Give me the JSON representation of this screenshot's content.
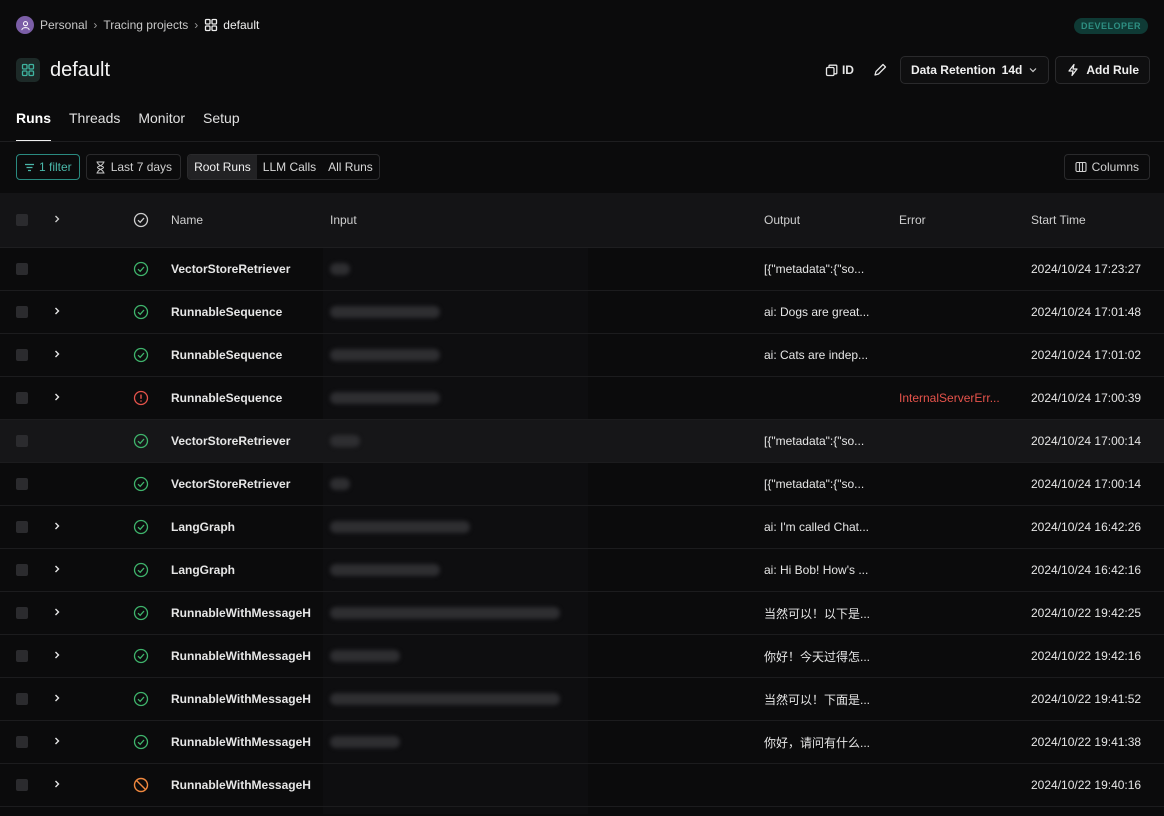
{
  "breadcrumb": {
    "workspace": "Personal",
    "section": "Tracing projects",
    "current": "default"
  },
  "badge": "DEVELOPER",
  "title": "default",
  "actions": {
    "id_label": "ID",
    "retention_label": "Data Retention",
    "retention_value": "14d",
    "add_rule_label": "Add Rule"
  },
  "tabs": [
    "Runs",
    "Threads",
    "Monitor",
    "Setup"
  ],
  "filters": {
    "filter_label": "1 filter",
    "days_label": "Last 7 days",
    "segments": [
      "Root Runs",
      "LLM Calls",
      "All Runs"
    ],
    "columns_label": "Columns"
  },
  "table": {
    "headers": {
      "name": "Name",
      "input": "Input",
      "output": "Output",
      "error": "Error",
      "start": "Start Time"
    },
    "rows": [
      {
        "expand": false,
        "status": "success",
        "name": "VectorStoreRetriever",
        "output": "[{\"metadata\":{\"so...",
        "error": "",
        "start": "2024/10/24 17:23:27"
      },
      {
        "expand": true,
        "status": "success",
        "name": "RunnableSequence",
        "output": "ai: Dogs are great...",
        "error": "",
        "start": "2024/10/24 17:01:48"
      },
      {
        "expand": true,
        "status": "success",
        "name": "RunnableSequence",
        "output": "ai: Cats are indep...",
        "error": "",
        "start": "2024/10/24 17:01:02"
      },
      {
        "expand": true,
        "status": "error",
        "name": "RunnableSequence",
        "output": "",
        "error": "InternalServerErr...",
        "start": "2024/10/24 17:00:39"
      },
      {
        "expand": false,
        "status": "success",
        "name": "VectorStoreRetriever",
        "output": "[{\"metadata\":{\"so...",
        "error": "",
        "start": "2024/10/24 17:00:14"
      },
      {
        "expand": false,
        "status": "success",
        "name": "VectorStoreRetriever",
        "output": "[{\"metadata\":{\"so...",
        "error": "",
        "start": "2024/10/24 17:00:14"
      },
      {
        "expand": true,
        "status": "success",
        "name": "LangGraph",
        "output": "ai: I'm called Chat...",
        "error": "",
        "start": "2024/10/24 16:42:26"
      },
      {
        "expand": true,
        "status": "success",
        "name": "LangGraph",
        "output": "ai: Hi Bob! How's ...",
        "error": "",
        "start": "2024/10/24 16:42:16"
      },
      {
        "expand": true,
        "status": "success",
        "name": "RunnableWithMessageH",
        "output": "当然可以！以下是...",
        "error": "",
        "start": "2024/10/22 19:42:25"
      },
      {
        "expand": true,
        "status": "success",
        "name": "RunnableWithMessageH",
        "output": "你好！今天过得怎...",
        "error": "",
        "start": "2024/10/22 19:42:16"
      },
      {
        "expand": true,
        "status": "success",
        "name": "RunnableWithMessageH",
        "output": "当然可以！下面是...",
        "error": "",
        "start": "2024/10/22 19:41:52"
      },
      {
        "expand": true,
        "status": "success",
        "name": "RunnableWithMessageH",
        "output": "你好，请问有什么...",
        "error": "",
        "start": "2024/10/22 19:41:38"
      },
      {
        "expand": true,
        "status": "cancelled",
        "name": "RunnableWithMessageH",
        "output": "",
        "error": "",
        "start": "2024/10/22 19:40:16"
      }
    ]
  },
  "colors": {
    "success": "#3fb46c",
    "error": "#e5534b",
    "cancelled": "#f0883e",
    "accent": "#2a8a80"
  }
}
